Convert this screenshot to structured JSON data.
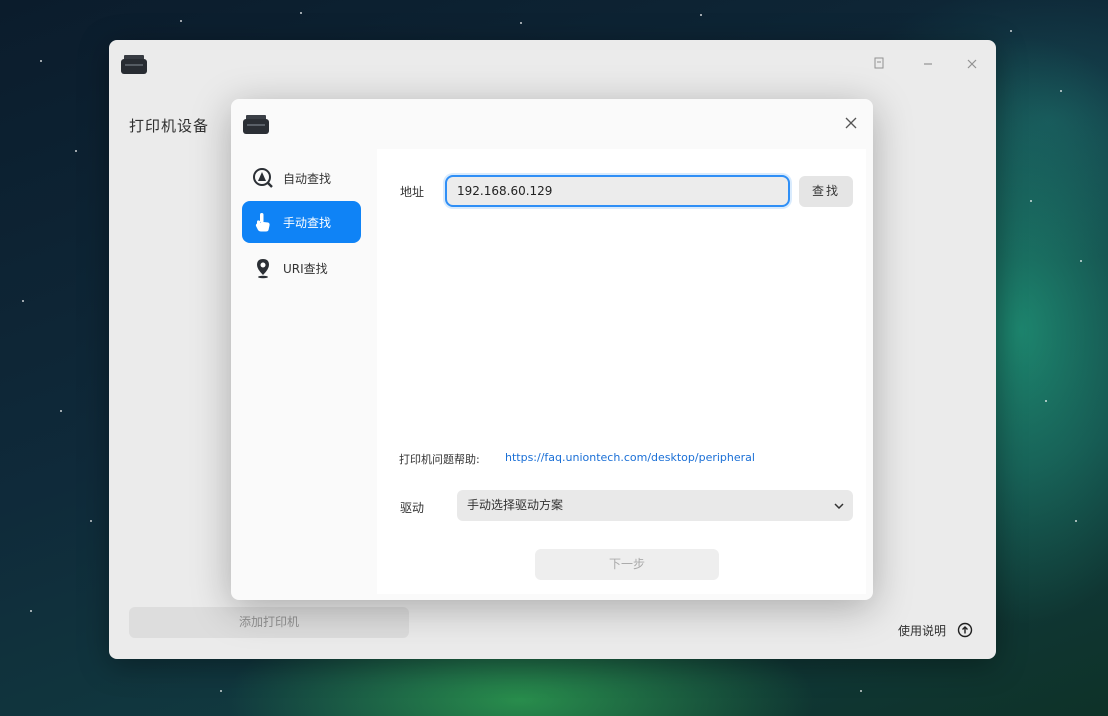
{
  "main_window": {
    "sidebar_title": "打印机设备",
    "add_printer_label": "添加打印机",
    "help_label": "使用说明"
  },
  "dialog": {
    "nav": [
      {
        "label": "自动查找",
        "icon": "search-printer-icon"
      },
      {
        "label": "手动查找",
        "icon": "hand-pointer-icon"
      },
      {
        "label": "URI查找",
        "icon": "location-pin-icon"
      }
    ],
    "address_label": "地址",
    "address_value": "192.168.60.129",
    "search_label": "查找",
    "faq_label": "打印机问题帮助:",
    "faq_url": "https://faq.uniontech.com/desktop/peripheral",
    "driver_label": "驱动",
    "driver_value": "手动选择驱动方案",
    "next_label": "下一步"
  },
  "colors": {
    "accent": "#0f83f6",
    "link": "#1a6fd6"
  }
}
